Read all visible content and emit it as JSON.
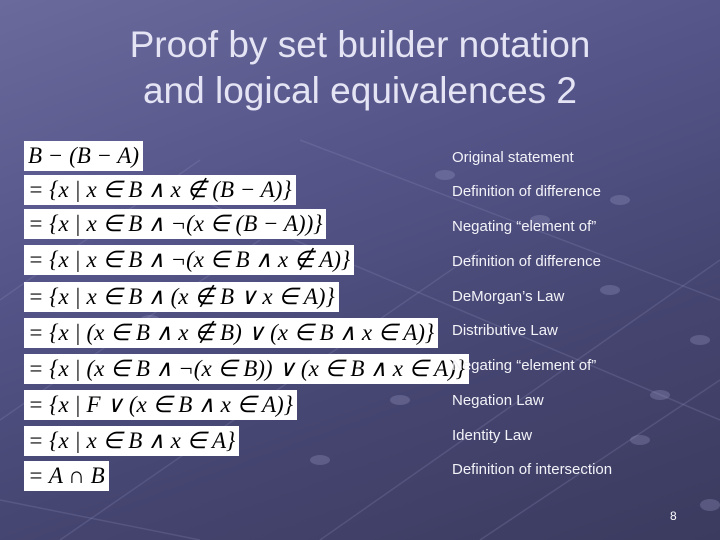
{
  "slide": {
    "title_line1": "Proof by set builder notation",
    "title_line2": "and logical equivalences 2",
    "page_number": "8",
    "background_color": "#55558a",
    "text_color": "#e4e4f4"
  },
  "steps": [
    {
      "formula": "B − (B − A)",
      "reason": "Original statement"
    },
    {
      "formula": "= {x | x ∈ B ∧ x ∉ (B − A)}",
      "reason": "Definition of difference"
    },
    {
      "formula": "= {x | x ∈ B ∧ ¬(x ∈ (B − A))}",
      "reason": "Negating “element of”"
    },
    {
      "formula": "= {x | x ∈ B ∧ ¬(x ∈ B ∧ x ∉ A)}",
      "reason": "Definition of difference"
    },
    {
      "formula": "= {x | x ∈ B ∧ (x ∉ B ∨ x ∈ A)}",
      "reason": "DeMorgan’s Law"
    },
    {
      "formula": "= {x | (x ∈ B ∧ x ∉ B) ∨ (x ∈ B ∧ x ∈ A)}",
      "reason": "Distributive Law"
    },
    {
      "formula": "= {x | (x ∈ B ∧ ¬(x ∈ B)) ∨ (x ∈ B ∧ x ∈ A)}",
      "reason": "Negating “element of”"
    },
    {
      "formula": "= {x | F ∨ (x ∈ B ∧ x ∈ A)}",
      "reason": "Negation Law"
    },
    {
      "formula": "= {x | x ∈ B ∧ x ∈ A}",
      "reason": "Identity Law"
    },
    {
      "formula": "= A ∩ B",
      "reason": "Definition of intersection"
    }
  ]
}
